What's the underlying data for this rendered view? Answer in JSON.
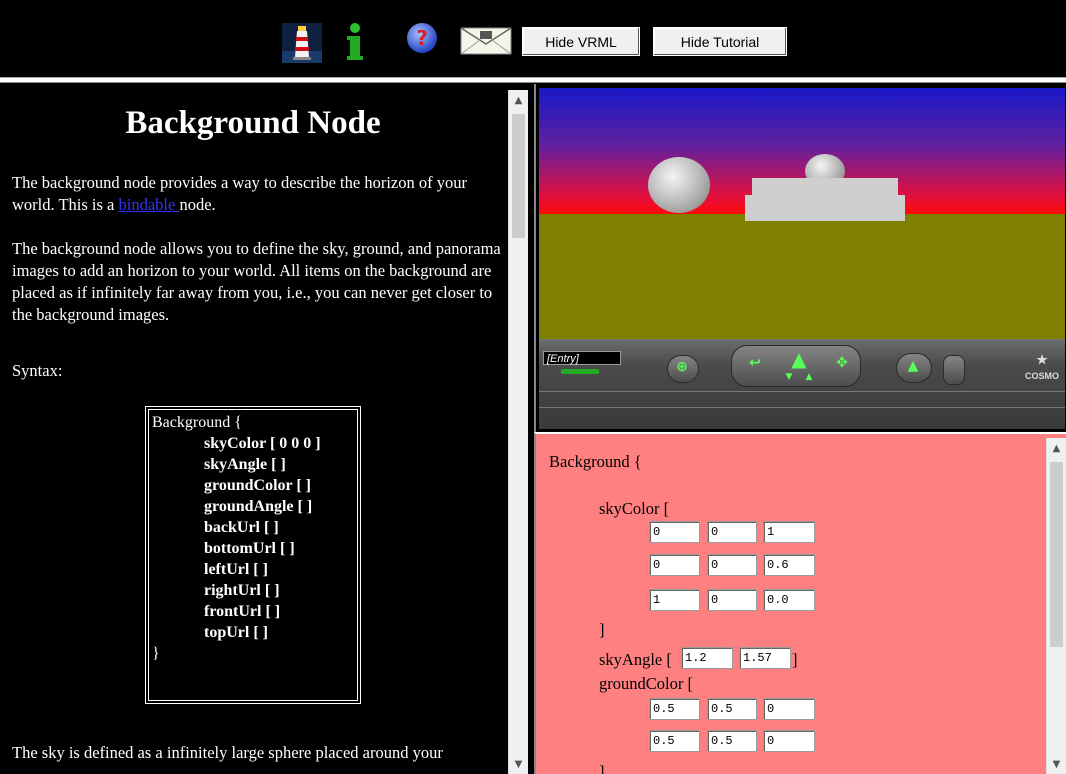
{
  "toolbar": {
    "icons": [
      "lighthouse-icon",
      "info-icon",
      "help-icon",
      "mail-icon"
    ],
    "hide_vrml_label": "Hide VRML",
    "hide_tutorial_label": "Hide Tutorial"
  },
  "tutorial": {
    "title": "Background Node",
    "para1_before": "The background node provides a way to describe the horizon of your world. This is a ",
    "para1_link": "bindable ",
    "para1_after": "node.",
    "para2": "The background node allows you to define the sky, ground, and panorama images to add an horizon to your world. All items on the background are placed as if infinitely far away from you, i.e., you can never get closer to the background images.",
    "syntax_label": "Syntax:",
    "syntax": {
      "open": "Background {",
      "fields": [
        "skyColor [ 0 0 0 ]",
        "skyAngle [ ]",
        "groundColor [ ]",
        "groundAngle [ ]",
        "backUrl [ ]",
        "bottomUrl [ ]",
        "leftUrl [ ]",
        "rightUrl [ ]",
        "frontUrl [ ]",
        "topUrl [ ]"
      ],
      "close": "}"
    },
    "para3": "The sky is defined as a infinitely large sphere placed around your"
  },
  "viewer": {
    "viewpoint_label": "[Entry]",
    "logo_text": "COSMO",
    "colors": {
      "sky_top": "#1818c8",
      "sky_bottom": "#ff0a0a",
      "ground": "#7f7f00"
    }
  },
  "editor": {
    "open": "Background {",
    "sky_color_label": "skyColor [",
    "sky_color_values": [
      [
        "0",
        "0",
        "1"
      ],
      [
        "0",
        "0",
        "0.6"
      ],
      [
        "1",
        "0",
        "0.0"
      ]
    ],
    "sky_close": "]",
    "sky_angle_label": "skyAngle [",
    "sky_angle_values": [
      "1.2",
      "1.57"
    ],
    "sky_angle_close": "]",
    "ground_color_label": "groundColor [",
    "ground_color_values": [
      [
        "0.5",
        "0.5",
        "0"
      ],
      [
        "0.5",
        "0.5",
        "0"
      ]
    ],
    "ground_close": "]",
    "background_color": "#ff8080"
  }
}
